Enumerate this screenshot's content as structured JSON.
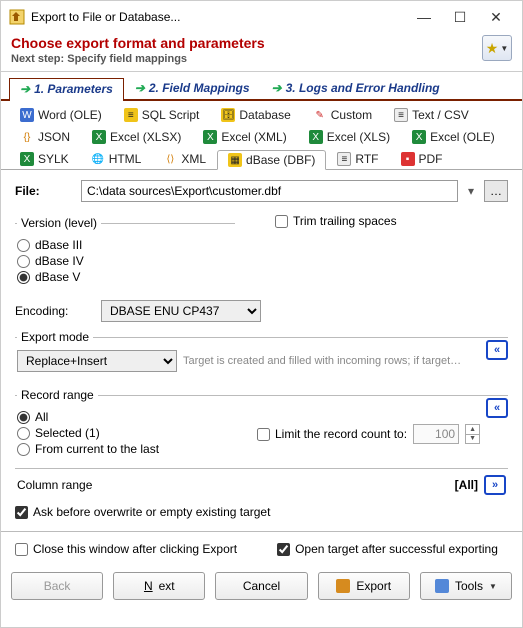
{
  "window": {
    "title": "Export to File or Database...",
    "minimize": "—",
    "maximize": "☐",
    "close": "✕"
  },
  "header": {
    "title": "Choose export format and parameters",
    "subtitle": "Next step: Specify field mappings"
  },
  "wizard_tabs": [
    {
      "label": "1. Parameters",
      "active": true
    },
    {
      "label": "2. Field Mappings",
      "active": false
    },
    {
      "label": "3. Logs and Error Handling",
      "active": false
    }
  ],
  "format_tabs": [
    {
      "label": "Word (OLE)"
    },
    {
      "label": "SQL Script"
    },
    {
      "label": "Database"
    },
    {
      "label": "Custom"
    },
    {
      "label": "Text / CSV"
    },
    {
      "label": "JSON"
    },
    {
      "label": "Excel (XLSX)"
    },
    {
      "label": "Excel (XML)"
    },
    {
      "label": "Excel (XLS)"
    },
    {
      "label": "Excel (OLE)"
    },
    {
      "label": "SYLK"
    },
    {
      "label": "HTML"
    },
    {
      "label": "XML"
    },
    {
      "label": "dBase (DBF)",
      "active": true
    },
    {
      "label": "RTF"
    },
    {
      "label": "PDF"
    }
  ],
  "file": {
    "label": "File:",
    "value": "C:\\data sources\\Export\\customer.dbf",
    "browse": "…"
  },
  "version": {
    "legend": "Version (level)",
    "options": [
      "dBase III",
      "dBase IV",
      "dBase V"
    ],
    "selected": "dBase V"
  },
  "trim": {
    "label": "Trim trailing spaces",
    "checked": false
  },
  "encoding": {
    "label": "Encoding:",
    "value": "DBASE ENU CP437"
  },
  "export_mode": {
    "legend": "Export mode",
    "value": "Replace+Insert",
    "description": "Target is created and filled with incoming rows; if target…",
    "expand": "«"
  },
  "record_range": {
    "legend": "Record range",
    "options": [
      "All",
      "Selected (1)",
      "From current to the last"
    ],
    "selected": "All",
    "limit_label": "Limit the record count to:",
    "limit_checked": false,
    "limit_value": "100",
    "expand": "«"
  },
  "column_range": {
    "legend": "Column range",
    "value": "[All]",
    "expand": "»"
  },
  "ask_overwrite": {
    "label": "Ask before overwrite or empty existing target",
    "checked": true
  },
  "footer": {
    "close_after": {
      "label": "Close this window after clicking Export",
      "checked": false
    },
    "open_after": {
      "label": "Open target after successful exporting",
      "checked": true
    }
  },
  "buttons": {
    "back": "Back",
    "next_prefix": "N",
    "next_rest": "ext",
    "cancel": "Cancel",
    "export": "Export",
    "tools": "Tools"
  }
}
